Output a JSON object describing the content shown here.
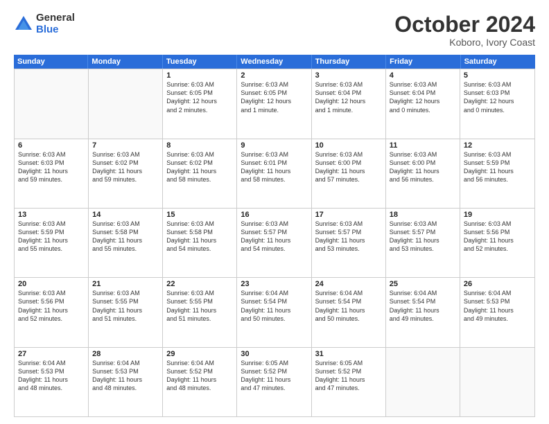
{
  "logo": {
    "general": "General",
    "blue": "Blue"
  },
  "title": "October 2024",
  "subtitle": "Koboro, Ivory Coast",
  "days": [
    "Sunday",
    "Monday",
    "Tuesday",
    "Wednesday",
    "Thursday",
    "Friday",
    "Saturday"
  ],
  "rows": [
    [
      {
        "day": "",
        "info": [],
        "empty": true
      },
      {
        "day": "",
        "info": [],
        "empty": true
      },
      {
        "day": "1",
        "info": [
          "Sunrise: 6:03 AM",
          "Sunset: 6:05 PM",
          "Daylight: 12 hours",
          "and 2 minutes."
        ],
        "empty": false
      },
      {
        "day": "2",
        "info": [
          "Sunrise: 6:03 AM",
          "Sunset: 6:05 PM",
          "Daylight: 12 hours",
          "and 1 minute."
        ],
        "empty": false
      },
      {
        "day": "3",
        "info": [
          "Sunrise: 6:03 AM",
          "Sunset: 6:04 PM",
          "Daylight: 12 hours",
          "and 1 minute."
        ],
        "empty": false
      },
      {
        "day": "4",
        "info": [
          "Sunrise: 6:03 AM",
          "Sunset: 6:04 PM",
          "Daylight: 12 hours",
          "and 0 minutes."
        ],
        "empty": false
      },
      {
        "day": "5",
        "info": [
          "Sunrise: 6:03 AM",
          "Sunset: 6:03 PM",
          "Daylight: 12 hours",
          "and 0 minutes."
        ],
        "empty": false
      }
    ],
    [
      {
        "day": "6",
        "info": [
          "Sunrise: 6:03 AM",
          "Sunset: 6:03 PM",
          "Daylight: 11 hours",
          "and 59 minutes."
        ],
        "empty": false
      },
      {
        "day": "7",
        "info": [
          "Sunrise: 6:03 AM",
          "Sunset: 6:02 PM",
          "Daylight: 11 hours",
          "and 59 minutes."
        ],
        "empty": false
      },
      {
        "day": "8",
        "info": [
          "Sunrise: 6:03 AM",
          "Sunset: 6:02 PM",
          "Daylight: 11 hours",
          "and 58 minutes."
        ],
        "empty": false
      },
      {
        "day": "9",
        "info": [
          "Sunrise: 6:03 AM",
          "Sunset: 6:01 PM",
          "Daylight: 11 hours",
          "and 58 minutes."
        ],
        "empty": false
      },
      {
        "day": "10",
        "info": [
          "Sunrise: 6:03 AM",
          "Sunset: 6:00 PM",
          "Daylight: 11 hours",
          "and 57 minutes."
        ],
        "empty": false
      },
      {
        "day": "11",
        "info": [
          "Sunrise: 6:03 AM",
          "Sunset: 6:00 PM",
          "Daylight: 11 hours",
          "and 56 minutes."
        ],
        "empty": false
      },
      {
        "day": "12",
        "info": [
          "Sunrise: 6:03 AM",
          "Sunset: 5:59 PM",
          "Daylight: 11 hours",
          "and 56 minutes."
        ],
        "empty": false
      }
    ],
    [
      {
        "day": "13",
        "info": [
          "Sunrise: 6:03 AM",
          "Sunset: 5:59 PM",
          "Daylight: 11 hours",
          "and 55 minutes."
        ],
        "empty": false
      },
      {
        "day": "14",
        "info": [
          "Sunrise: 6:03 AM",
          "Sunset: 5:58 PM",
          "Daylight: 11 hours",
          "and 55 minutes."
        ],
        "empty": false
      },
      {
        "day": "15",
        "info": [
          "Sunrise: 6:03 AM",
          "Sunset: 5:58 PM",
          "Daylight: 11 hours",
          "and 54 minutes."
        ],
        "empty": false
      },
      {
        "day": "16",
        "info": [
          "Sunrise: 6:03 AM",
          "Sunset: 5:57 PM",
          "Daylight: 11 hours",
          "and 54 minutes."
        ],
        "empty": false
      },
      {
        "day": "17",
        "info": [
          "Sunrise: 6:03 AM",
          "Sunset: 5:57 PM",
          "Daylight: 11 hours",
          "and 53 minutes."
        ],
        "empty": false
      },
      {
        "day": "18",
        "info": [
          "Sunrise: 6:03 AM",
          "Sunset: 5:57 PM",
          "Daylight: 11 hours",
          "and 53 minutes."
        ],
        "empty": false
      },
      {
        "day": "19",
        "info": [
          "Sunrise: 6:03 AM",
          "Sunset: 5:56 PM",
          "Daylight: 11 hours",
          "and 52 minutes."
        ],
        "empty": false
      }
    ],
    [
      {
        "day": "20",
        "info": [
          "Sunrise: 6:03 AM",
          "Sunset: 5:56 PM",
          "Daylight: 11 hours",
          "and 52 minutes."
        ],
        "empty": false
      },
      {
        "day": "21",
        "info": [
          "Sunrise: 6:03 AM",
          "Sunset: 5:55 PM",
          "Daylight: 11 hours",
          "and 51 minutes."
        ],
        "empty": false
      },
      {
        "day": "22",
        "info": [
          "Sunrise: 6:03 AM",
          "Sunset: 5:55 PM",
          "Daylight: 11 hours",
          "and 51 minutes."
        ],
        "empty": false
      },
      {
        "day": "23",
        "info": [
          "Sunrise: 6:04 AM",
          "Sunset: 5:54 PM",
          "Daylight: 11 hours",
          "and 50 minutes."
        ],
        "empty": false
      },
      {
        "day": "24",
        "info": [
          "Sunrise: 6:04 AM",
          "Sunset: 5:54 PM",
          "Daylight: 11 hours",
          "and 50 minutes."
        ],
        "empty": false
      },
      {
        "day": "25",
        "info": [
          "Sunrise: 6:04 AM",
          "Sunset: 5:54 PM",
          "Daylight: 11 hours",
          "and 49 minutes."
        ],
        "empty": false
      },
      {
        "day": "26",
        "info": [
          "Sunrise: 6:04 AM",
          "Sunset: 5:53 PM",
          "Daylight: 11 hours",
          "and 49 minutes."
        ],
        "empty": false
      }
    ],
    [
      {
        "day": "27",
        "info": [
          "Sunrise: 6:04 AM",
          "Sunset: 5:53 PM",
          "Daylight: 11 hours",
          "and 48 minutes."
        ],
        "empty": false
      },
      {
        "day": "28",
        "info": [
          "Sunrise: 6:04 AM",
          "Sunset: 5:53 PM",
          "Daylight: 11 hours",
          "and 48 minutes."
        ],
        "empty": false
      },
      {
        "day": "29",
        "info": [
          "Sunrise: 6:04 AM",
          "Sunset: 5:52 PM",
          "Daylight: 11 hours",
          "and 48 minutes."
        ],
        "empty": false
      },
      {
        "day": "30",
        "info": [
          "Sunrise: 6:05 AM",
          "Sunset: 5:52 PM",
          "Daylight: 11 hours",
          "and 47 minutes."
        ],
        "empty": false
      },
      {
        "day": "31",
        "info": [
          "Sunrise: 6:05 AM",
          "Sunset: 5:52 PM",
          "Daylight: 11 hours",
          "and 47 minutes."
        ],
        "empty": false
      },
      {
        "day": "",
        "info": [],
        "empty": true
      },
      {
        "day": "",
        "info": [],
        "empty": true
      }
    ]
  ]
}
